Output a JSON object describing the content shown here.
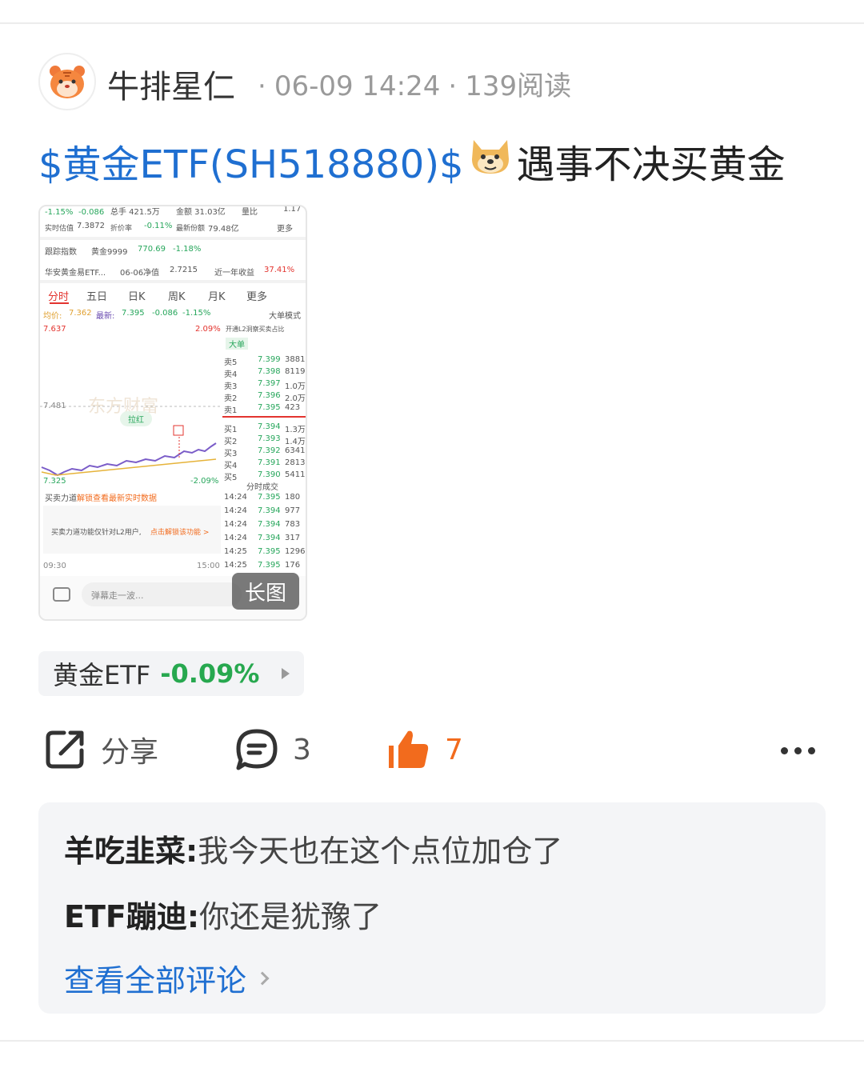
{
  "post": {
    "author": "牛排星仁",
    "time": "06-09 14:24",
    "reads": "139阅读",
    "separator": "·",
    "stock_link": "$黄金ETF(SH518880)$",
    "title_text": "遇事不决买黄金"
  },
  "screenshot": {
    "badge": "长图",
    "row1": {
      "change_pct": "-1.15%",
      "change": "-0.086",
      "vol": "总手 421.5万",
      "amount": "金额 31.03亿",
      "ratio_label": "量比",
      "ratio": "1.17"
    },
    "row2": {
      "est_label": "实时估值",
      "est": "7.3872",
      "disc_label": "折价率",
      "disc": "-0.11%",
      "share_label": "最新份额",
      "share": "79.48亿",
      "more": "更多"
    },
    "row3": {
      "track_label": "跟踪指数",
      "index_name": "黄金9999",
      "index_val": "770.69",
      "index_pct": "-1.18%"
    },
    "row4": {
      "fund_name": "华安黄金易ETF...",
      "nav_label": "06-06净值",
      "nav": "2.7215",
      "year_label": "近一年收益",
      "year": "37.41%"
    },
    "tabs": [
      "分时",
      "五日",
      "日K",
      "周K",
      "月K",
      "更多"
    ],
    "price_row": {
      "avg_label": "均价:",
      "avg": "7.362",
      "last_label": "最新:",
      "last": "7.395",
      "chg": "-0.086",
      "pct": "-1.15%",
      "mode": "大单模式"
    },
    "chart": {
      "high": "7.637",
      "high_pct": "2.09%",
      "mid": "7.481",
      "low": "7.325",
      "low_pct": "-2.09%",
      "start": "09:30",
      "end": "15:00",
      "tag": "拉红",
      "watermark": "东方财富"
    },
    "l2_hint": "开通L2洞察买卖占比",
    "big_order": "大单",
    "asks": [
      {
        "label": "卖5",
        "price": "7.399",
        "vol": "3881"
      },
      {
        "label": "卖4",
        "price": "7.398",
        "vol": "8119"
      },
      {
        "label": "卖3",
        "price": "7.397",
        "vol": "1.0万"
      },
      {
        "label": "卖2",
        "price": "7.396",
        "vol": "2.0万"
      },
      {
        "label": "卖1",
        "price": "7.395",
        "vol": "423"
      }
    ],
    "bids": [
      {
        "label": "买1",
        "price": "7.394",
        "vol": "1.3万"
      },
      {
        "label": "买2",
        "price": "7.393",
        "vol": "1.4万"
      },
      {
        "label": "买3",
        "price": "7.392",
        "vol": "6341"
      },
      {
        "label": "买4",
        "price": "7.391",
        "vol": "2813"
      },
      {
        "label": "买5",
        "price": "7.390",
        "vol": "5411"
      }
    ],
    "trades_label": "分时成交",
    "trades": [
      {
        "time": "14:24",
        "price": "7.395",
        "vol": "180"
      },
      {
        "time": "14:24",
        "price": "7.394",
        "vol": "977"
      },
      {
        "time": "14:24",
        "price": "7.394",
        "vol": "783"
      },
      {
        "time": "14:24",
        "price": "7.394",
        "vol": "317"
      },
      {
        "time": "14:25",
        "price": "7.395",
        "vol": "1296"
      },
      {
        "time": "14:25",
        "price": "7.395",
        "vol": "176"
      }
    ],
    "power_label": "买卖力道",
    "unlock": "解锁查看最新实时数据",
    "l2_only": "买卖力道功能仅针对L2用户,",
    "l2_link": "点击解锁该功能 >",
    "comment_placeholder": "弹幕走一波..."
  },
  "quote": {
    "name": "黄金ETF",
    "change": "-0.09%"
  },
  "actions": {
    "share": "分享",
    "comments": "3",
    "likes": "7"
  },
  "comments": [
    {
      "author": "羊吃韭菜:",
      "text": "我今天也在这个点位加仓了"
    },
    {
      "author": "ETF蹦迪:",
      "text": "你还是犹豫了"
    }
  ],
  "view_all": "查看全部评论",
  "colors": {
    "link": "#1f6fd1",
    "up": "#e3342f",
    "down": "#26a65b",
    "like": "#f26b1d"
  }
}
